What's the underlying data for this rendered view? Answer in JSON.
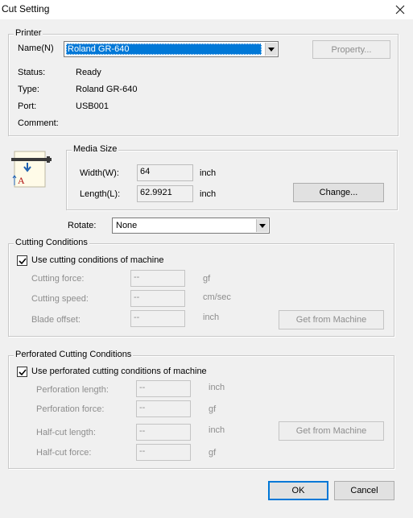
{
  "window": {
    "title": "Cut Setting",
    "close_icon": "close-icon"
  },
  "printer": {
    "legend": "Printer",
    "name_label": "Name(N)",
    "name_value": "Roland GR-640",
    "property_button": "Property...",
    "status_label": "Status:",
    "status_value": "Ready",
    "type_label": "Type:",
    "type_value": "Roland GR-640",
    "port_label": "Port:",
    "port_value": "USB001",
    "comment_label": "Comment:",
    "comment_value": ""
  },
  "media": {
    "legend": "Media Size",
    "width_label": "Width(W):",
    "width_value": "64",
    "width_unit": "inch",
    "length_label": "Length(L):",
    "length_value": "62.9921",
    "length_unit": "inch",
    "change_button": "Change..."
  },
  "rotate": {
    "label": "Rotate:",
    "value": "None"
  },
  "cutting": {
    "legend": "Cutting Conditions",
    "checkbox_label": "Use cutting conditions of machine",
    "checked": true,
    "force_label": "Cutting force:",
    "force_value": "--",
    "force_unit": "gf",
    "speed_label": "Cutting speed:",
    "speed_value": "--",
    "speed_unit": "cm/sec",
    "offset_label": "Blade offset:",
    "offset_value": "--",
    "offset_unit": "inch",
    "get_button": "Get from Machine"
  },
  "perforated": {
    "legend": "Perforated Cutting Conditions",
    "checkbox_label": "Use perforated cutting conditions of machine",
    "checked": true,
    "perf_length_label": "Perforation length:",
    "perf_length_value": "--",
    "perf_length_unit": "inch",
    "perf_force_label": "Perforation  force:",
    "perf_force_value": "--",
    "perf_force_unit": "gf",
    "half_length_label": "Half-cut length:",
    "half_length_value": "--",
    "half_length_unit": "inch",
    "half_force_label": "Half-cut force:",
    "half_force_value": "--",
    "half_force_unit": "gf",
    "get_button": "Get from Machine"
  },
  "footer": {
    "ok_button": "OK",
    "cancel_button": "Cancel"
  },
  "colors": {
    "accent": "#0078d7",
    "disabled_text": "#8d8d8d"
  }
}
